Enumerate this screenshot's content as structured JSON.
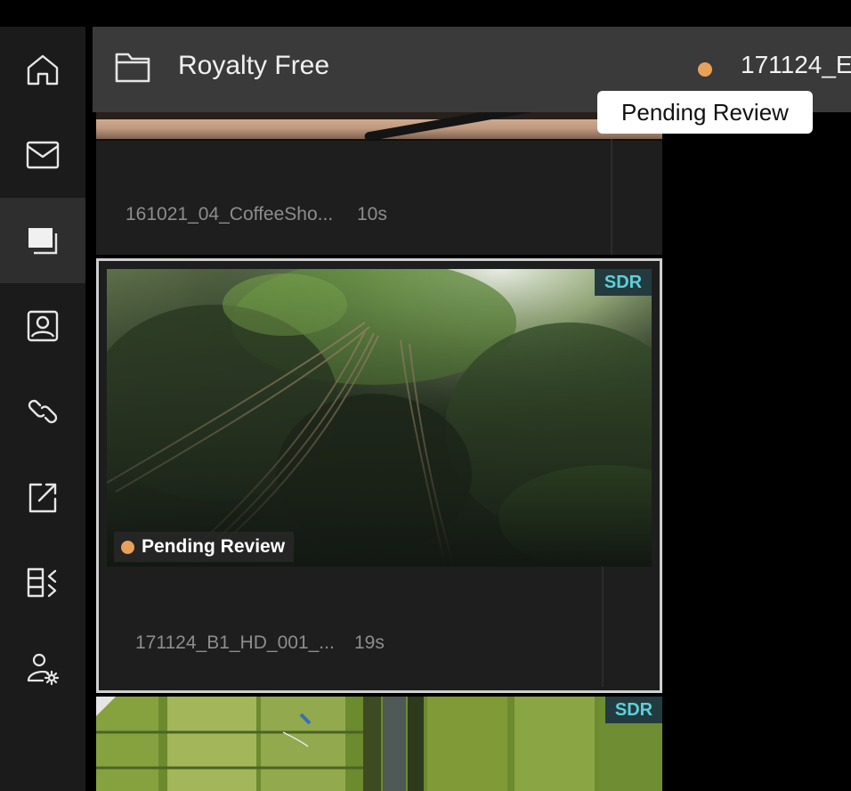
{
  "header": {
    "title": "Royalty Free",
    "current_clip": "171124_E",
    "status_color": "#e8a15b"
  },
  "tooltip": {
    "text": "Pending Review"
  },
  "sidebar": {
    "items": [
      {
        "name": "home",
        "icon": "home-icon"
      },
      {
        "name": "inbox",
        "icon": "envelope-icon"
      },
      {
        "name": "media",
        "icon": "media-stack-icon",
        "active": true
      },
      {
        "name": "presentation",
        "icon": "person-frame-icon"
      },
      {
        "name": "links",
        "icon": "link-icon"
      },
      {
        "name": "share",
        "icon": "share-icon"
      },
      {
        "name": "compare",
        "icon": "compare-icon"
      },
      {
        "name": "user-settings",
        "icon": "user-gear-icon"
      }
    ]
  },
  "clips": [
    {
      "name": "161021_04_CoffeeSho...",
      "duration": "10s"
    },
    {
      "name": "171124_B1_HD_001_...",
      "duration": "19s",
      "badge": "SDR",
      "status": "Pending Review"
    },
    {
      "badge": "SDR"
    }
  ]
}
